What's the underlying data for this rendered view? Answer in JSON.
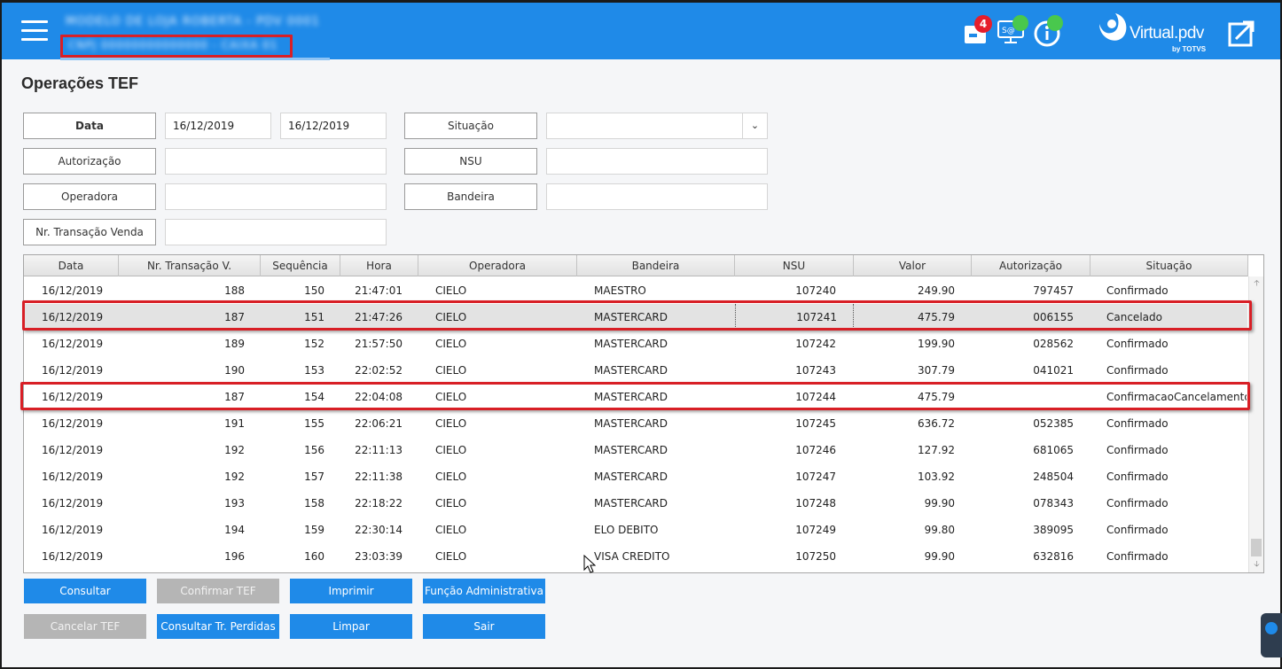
{
  "header": {
    "store_name": "MODELO DE LOJA ROBERTA - PDV 0001",
    "store_detail": "CNPJ 00000000000000 - CAIXA 01",
    "notification_count": "4",
    "brand": "Virtual.pdv",
    "brand_by": "by TOTVS",
    "colors": {
      "bar": "#1f8ae8",
      "badge": "#e61e2b",
      "status_ok": "#49c84d"
    }
  },
  "page": {
    "title": "Operações TEF"
  },
  "filters": {
    "data_label": "Data",
    "data_from": "16/12/2019",
    "data_to": "16/12/2019",
    "situacao_label": "Situação",
    "situacao_value": "",
    "autorizacao_label": "Autorização",
    "autorizacao_value": "",
    "nsu_label": "NSU",
    "nsu_value": "",
    "operadora_label": "Operadora",
    "operadora_value": "",
    "bandeira_label": "Bandeira",
    "bandeira_value": "",
    "nr_transacao_label": "Nr. Transação Venda",
    "nr_transacao_value": ""
  },
  "table": {
    "columns": [
      "Data",
      "Nr. Transação V.",
      "Sequência",
      "Hora",
      "Operadora",
      "Bandeira",
      "NSU",
      "Valor",
      "Autorização",
      "Situação"
    ],
    "rows": [
      [
        "16/12/2019",
        "188",
        "150",
        "21:47:01",
        "CIELO",
        "MAESTRO",
        "107240",
        "249.90",
        "797457",
        "Confirmado"
      ],
      [
        "16/12/2019",
        "187",
        "151",
        "21:47:26",
        "CIELO",
        "MASTERCARD",
        "107241",
        "475.79",
        "006155",
        "Cancelado"
      ],
      [
        "16/12/2019",
        "189",
        "152",
        "21:57:50",
        "CIELO",
        "MASTERCARD",
        "107242",
        "199.90",
        "028562",
        "Confirmado"
      ],
      [
        "16/12/2019",
        "190",
        "153",
        "22:02:52",
        "CIELO",
        "MASTERCARD",
        "107243",
        "307.79",
        "041021",
        "Confirmado"
      ],
      [
        "16/12/2019",
        "187",
        "154",
        "22:04:08",
        "CIELO",
        "MASTERCARD",
        "107244",
        "475.79",
        "",
        "ConfirmacaoCancelamento"
      ],
      [
        "16/12/2019",
        "191",
        "155",
        "22:06:21",
        "CIELO",
        "MASTERCARD",
        "107245",
        "636.72",
        "052385",
        "Confirmado"
      ],
      [
        "16/12/2019",
        "192",
        "156",
        "22:11:13",
        "CIELO",
        "MASTERCARD",
        "107246",
        "127.92",
        "681065",
        "Confirmado"
      ],
      [
        "16/12/2019",
        "192",
        "157",
        "22:11:38",
        "CIELO",
        "MASTERCARD",
        "107247",
        "103.92",
        "248504",
        "Confirmado"
      ],
      [
        "16/12/2019",
        "193",
        "158",
        "22:18:22",
        "CIELO",
        "MASTERCARD",
        "107248",
        "99.90",
        "078343",
        "Confirmado"
      ],
      [
        "16/12/2019",
        "194",
        "159",
        "22:30:14",
        "CIELO",
        "ELO DEBITO",
        "107249",
        "99.80",
        "389095",
        "Confirmado"
      ],
      [
        "16/12/2019",
        "196",
        "160",
        "23:03:39",
        "CIELO",
        "VISA CREDITO",
        "107250",
        "99.90",
        "632816",
        "Confirmado"
      ]
    ],
    "selected_row": 1,
    "highlighted_rows": [
      1,
      4
    ]
  },
  "buttons": {
    "consultar": "Consultar",
    "confirmar_tef": "Confirmar TEF",
    "imprimir": "Imprimir",
    "funcao_admin": "Função Administrativa",
    "cancelar_tef": "Cancelar TEF",
    "consultar_perdidas": "Consultar Tr. Perdidas",
    "limpar": "Limpar",
    "sair": "Sair"
  },
  "icons": [
    "menu-icon",
    "cash-register-icon",
    "pos-monitor-icon",
    "info-icon",
    "open-window-icon",
    "scroll-up-icon",
    "scroll-down-icon",
    "chevron-down-icon"
  ]
}
